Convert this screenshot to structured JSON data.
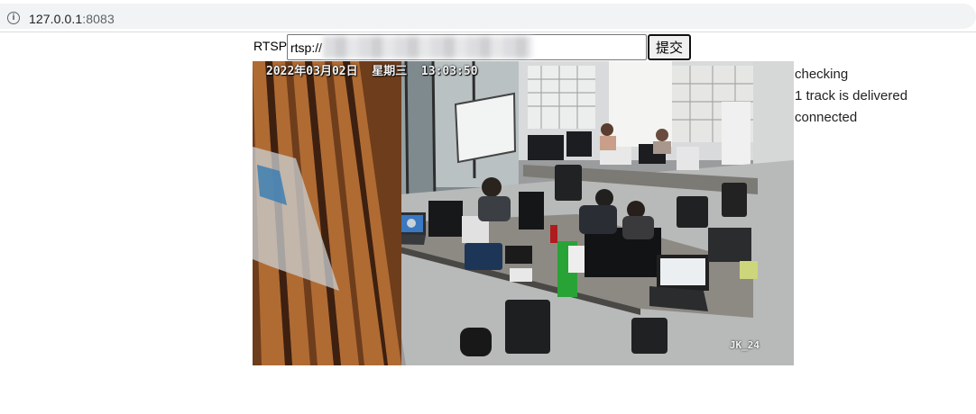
{
  "browser": {
    "url_host": "127.0.0.1",
    "url_port": ":8083",
    "info_icon": "info-icon"
  },
  "form": {
    "label": "RTSP:",
    "input_value": "rtsp://",
    "submit_label": "提交"
  },
  "video": {
    "osd_datetime": "2022年03月02日  星期三  13:03:50",
    "osd_camera": "JK_24"
  },
  "status": {
    "lines": [
      "checking",
      "1 track is delivered",
      "connected"
    ]
  }
}
